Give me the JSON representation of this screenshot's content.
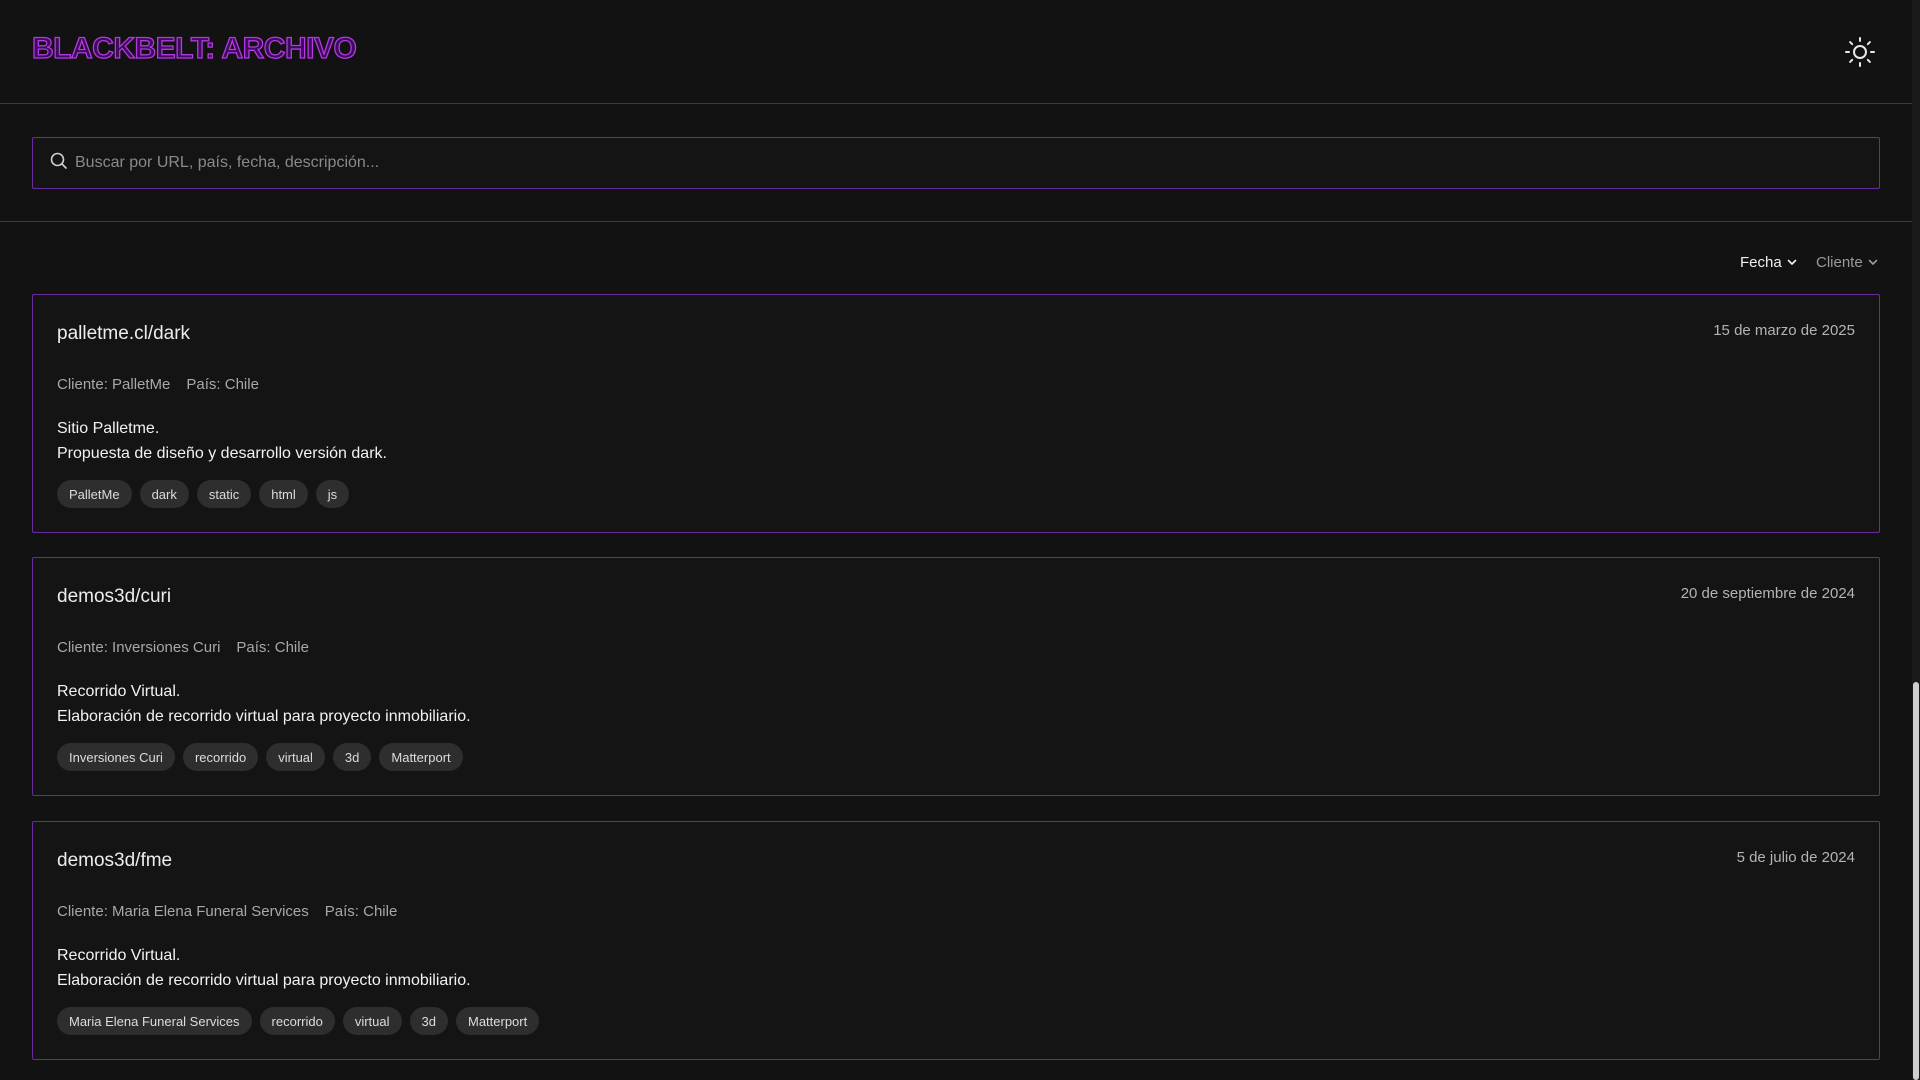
{
  "header": {
    "title": "BLACKBELT: ARCHIVO",
    "theme_icon": "sun-icon"
  },
  "search": {
    "placeholder": "Buscar por URL, país, fecha, descripción...",
    "icon": "search-icon"
  },
  "sort": {
    "date_label": "Fecha",
    "client_label": "Cliente",
    "active": "Fecha"
  },
  "entries": [
    {
      "title": "palletme.cl/dark",
      "date": "15 de marzo de 2025",
      "client": "Cliente: PalletMe",
      "country": "País: Chile",
      "summary": "Sitio Palletme.",
      "detail": "Propuesta de diseño y desarrollo versión dark.",
      "tags": [
        "PalletMe",
        "dark",
        "static",
        "html",
        "js"
      ]
    },
    {
      "title": "demos3d/curi",
      "date": "20 de septiembre de 2024",
      "client": "Cliente: Inversiones Curi",
      "country": "País: Chile",
      "summary": "Recorrido Virtual.",
      "detail": "Elaboración de recorrido virtual para proyecto inmobiliario.",
      "tags": [
        "Inversiones Curi",
        "recorrido",
        "virtual",
        "3d",
        "Matterport"
      ]
    },
    {
      "title": "demos3d/fme",
      "date": "5 de julio de 2024",
      "client": "Cliente: Maria Elena Funeral Services",
      "country": "País: Chile",
      "summary": "Recorrido Virtual.",
      "detail": "Elaboración de recorrido virtual para proyecto inmobiliario.",
      "tags": [
        "Maria Elena Funeral Services",
        "recorrido",
        "virtual",
        "3d",
        "Matterport"
      ]
    }
  ],
  "colors": {
    "accent": "#6a2aa0",
    "brand_stroke": "#b23adf",
    "background": "#121212"
  }
}
